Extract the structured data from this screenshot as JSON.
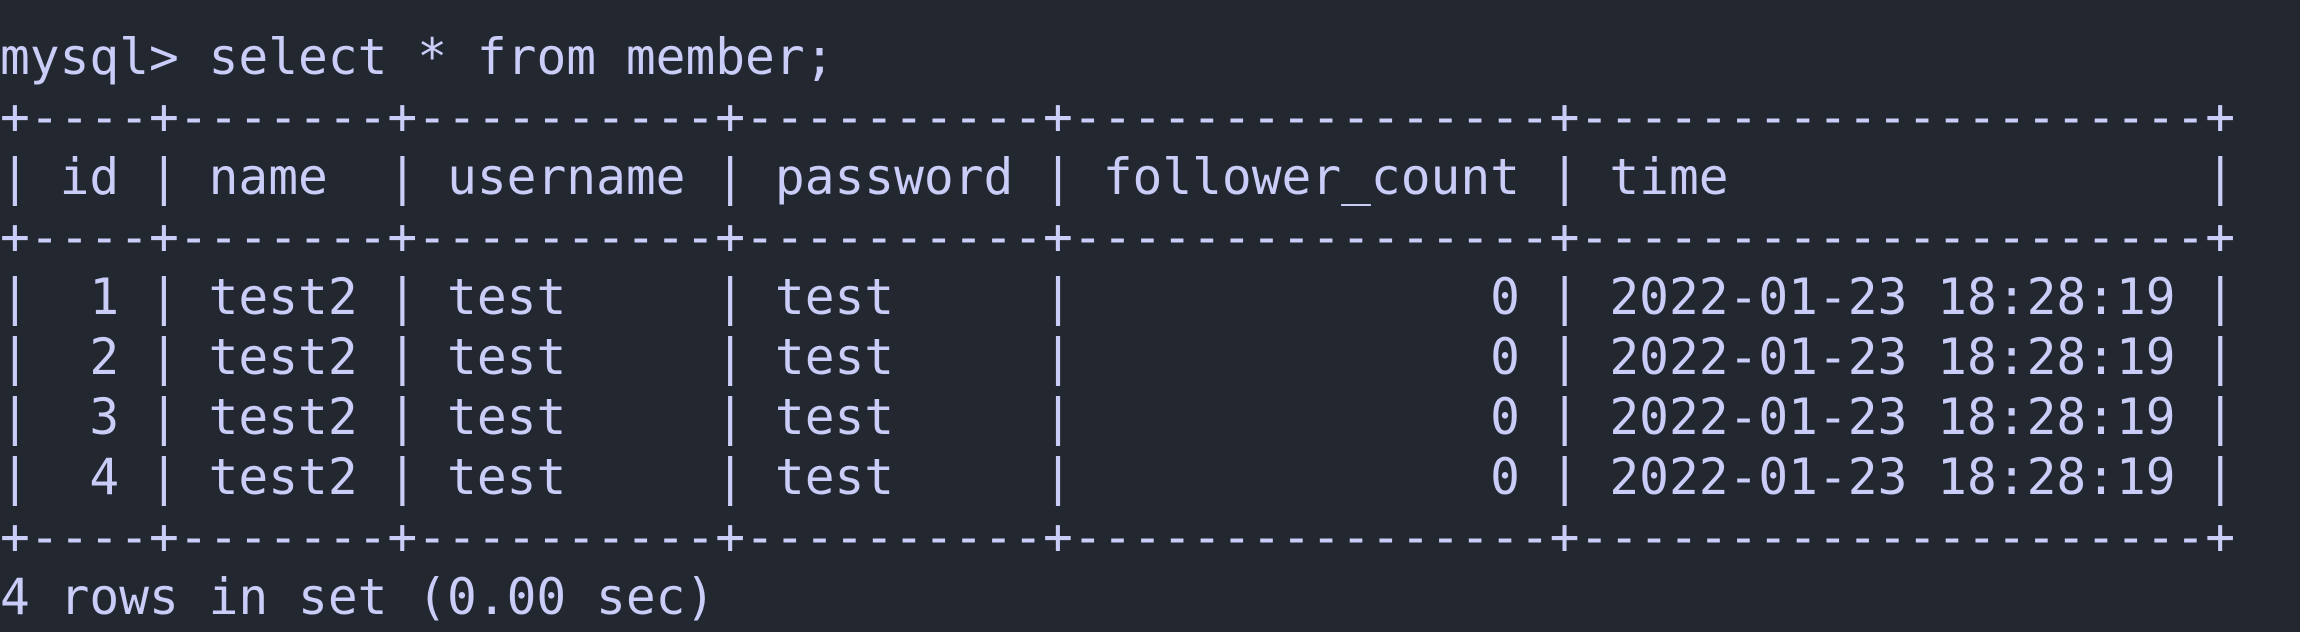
{
  "terminal": {
    "prompt": "mysql>",
    "command": "select * from member;",
    "result": {
      "columns": [
        "id",
        "name",
        "username",
        "password",
        "follower_count",
        "time"
      ],
      "rows": [
        [
          "1",
          "test2",
          "test",
          "test",
          "0",
          "2022-01-23 18:28:19"
        ],
        [
          "2",
          "test2",
          "test",
          "test",
          "0",
          "2022-01-23 18:28:19"
        ],
        [
          "3",
          "test2",
          "test",
          "test",
          "0",
          "2022-01-23 18:28:19"
        ],
        [
          "4",
          "test2",
          "test",
          "test",
          "0",
          "2022-01-23 18:28:19"
        ]
      ],
      "summary": "4 rows in set (0.00 sec)"
    }
  },
  "colors": {
    "background": "#232730",
    "text": "#c9cdf7"
  }
}
